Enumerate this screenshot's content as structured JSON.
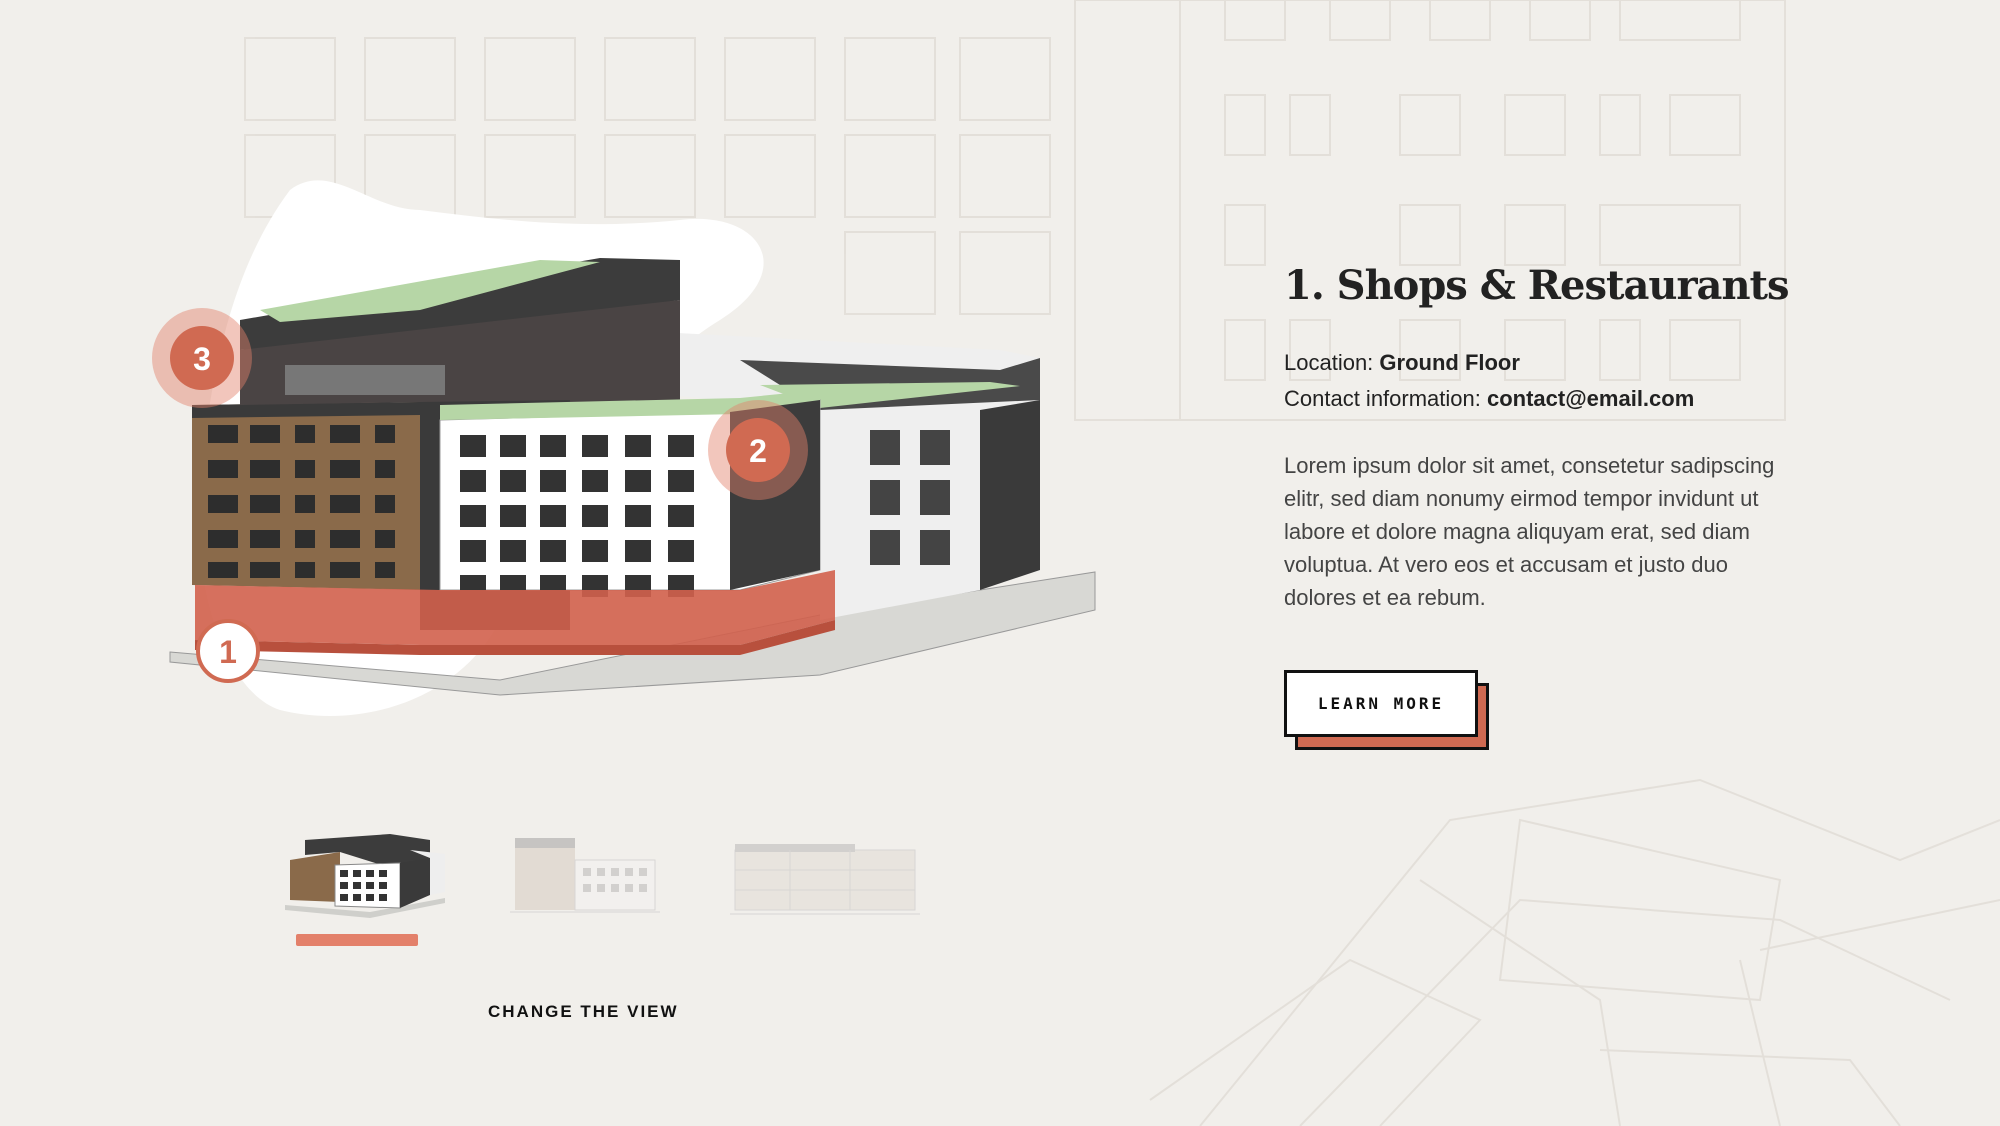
{
  "colors": {
    "background": "#f1efeb",
    "accent": "#d06a52",
    "accent_light": "#e3806a",
    "text": "#222222"
  },
  "markers": [
    {
      "label": "1",
      "style": "outline"
    },
    {
      "label": "2",
      "style": "filled"
    },
    {
      "label": "3",
      "style": "filled"
    }
  ],
  "info": {
    "title": "1. Shops & Restaurants",
    "location_label": "Location: ",
    "location_value": "Ground Floor",
    "contact_label": "Contact information: ",
    "contact_value": "contact@email.com",
    "description": "Lorem ipsum dolor sit amet, consetetur sadipscing elitr, sed diam nonumy eirmod tempor invidunt ut labore et dolore magna aliquyam erat, sed diam voluptua. At vero eos et accusam et justo duo dolores et ea rebum."
  },
  "button": {
    "label": "LEARN MORE"
  },
  "views": {
    "active_index": 0,
    "change_label": "CHANGE THE VIEW"
  }
}
